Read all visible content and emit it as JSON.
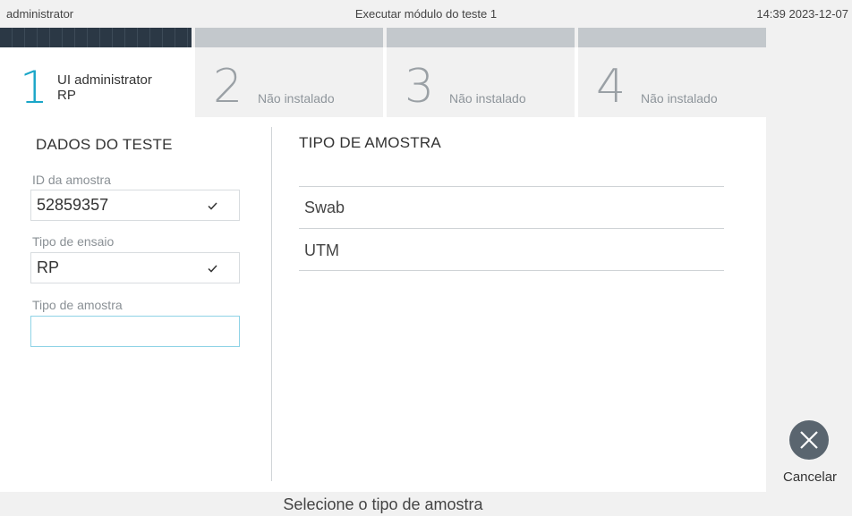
{
  "topbar": {
    "user": "administrator",
    "title": "Executar módulo do teste 1",
    "clock": "14:39 2023-12-07"
  },
  "tabs": [
    {
      "num": "1",
      "label_line1": "UI administrator",
      "label_line2": "RP",
      "active": true
    },
    {
      "num": "2",
      "label": "Não instalado"
    },
    {
      "num": "3",
      "label": "Não instalado"
    },
    {
      "num": "4",
      "label": "Não instalado"
    }
  ],
  "test_data": {
    "title": "DADOS DO TESTE",
    "sample_id_label": "ID da amostra",
    "sample_id_value": "52859357",
    "assay_type_label": "Tipo de ensaio",
    "assay_type_value": "RP",
    "sample_type_label": "Tipo de amostra",
    "sample_type_value": ""
  },
  "sample_type_panel": {
    "title": "TIPO DE AMOSTRA",
    "options": [
      "Swab",
      "UTM"
    ]
  },
  "cancel": {
    "label": "Cancelar",
    "icon": "close-icon"
  },
  "status": "Selecione o tipo de amostra",
  "colors": {
    "accent": "#1aa6c8",
    "active_bar": "#2b3845",
    "inactive_bar": "#c3c8cc"
  }
}
